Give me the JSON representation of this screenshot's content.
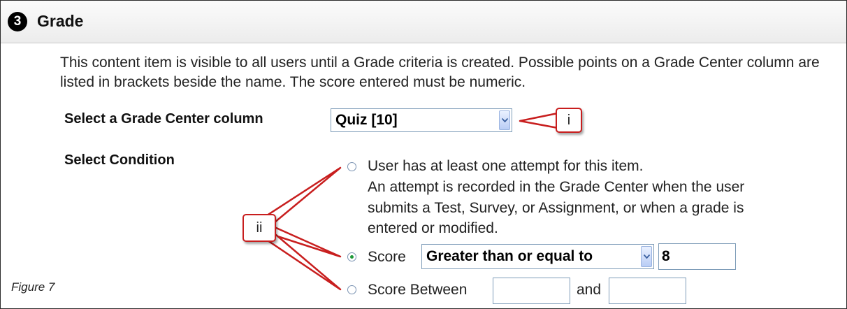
{
  "header": {
    "step_number": "3",
    "title": "Grade"
  },
  "description": "This content item is visible to all users until a Grade criteria is created. Possible points on a Grade Center column are listed in brackets beside the name. The score entered must be numeric.",
  "grade_column": {
    "label": "Select a Grade Center column",
    "selected": "Quiz [10]"
  },
  "condition": {
    "label": "Select Condition",
    "option_attempt": {
      "line1": "User has at least one attempt for this item.",
      "line2": "An attempt is recorded in the Grade Center when the user",
      "line3": "submits a Test, Survey, or Assignment, or when a grade is",
      "line4": "entered or modified.",
      "checked": false
    },
    "option_score": {
      "label": "Score",
      "operator": "Greater than or equal to",
      "value": "8",
      "checked": true
    },
    "option_between": {
      "label": "Score Between",
      "and_label": "and",
      "low": "",
      "high": "",
      "checked": false
    }
  },
  "callouts": {
    "i": "i",
    "ii": "ii"
  },
  "caption": "Figure 7",
  "colors": {
    "callout_border": "#c81e1e",
    "radio_selected": "#1f9a3a"
  }
}
